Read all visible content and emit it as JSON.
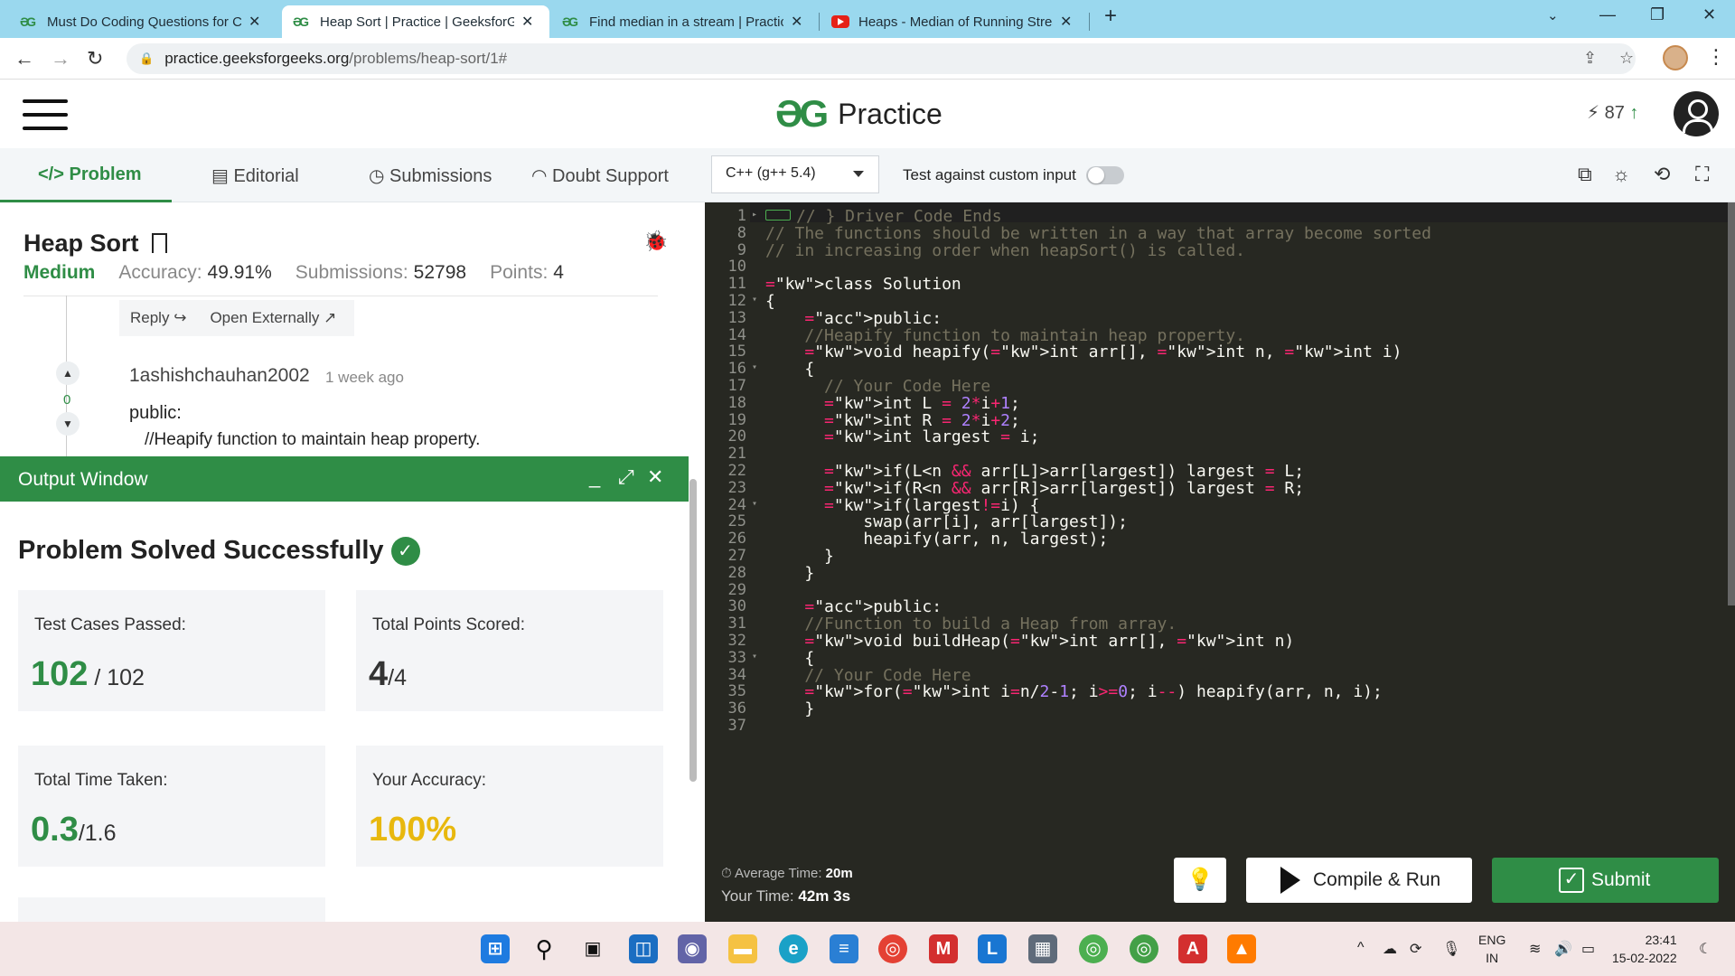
{
  "browser": {
    "tabs": [
      {
        "title": "Must Do Coding Questions for C",
        "favicon": "gfg-icon",
        "active": false
      },
      {
        "title": "Heap Sort | Practice | GeeksforGe",
        "favicon": "gfg-icon",
        "active": true
      },
      {
        "title": "Find median in a stream | Practic",
        "favicon": "gfg-icon",
        "active": false
      },
      {
        "title": "Heaps - Median of Running Strea",
        "favicon": "youtube-icon",
        "active": false
      }
    ],
    "url_host": "practice.geeksforgeeks.org",
    "url_path": "/problems/heap-sort/1#"
  },
  "site": {
    "logo_mark": "ƏG",
    "logo_text": "Practice",
    "streak": "87"
  },
  "problem_tabs": [
    "Problem",
    "Editorial",
    "Submissions",
    "Doubt Support"
  ],
  "problem_tab_icons": [
    "</>",
    "▤",
    "◷",
    "◠"
  ],
  "editor_toolbar": {
    "language": "C++ (g++ 5.4)",
    "custom_input_label": "Test against custom input"
  },
  "problem": {
    "title": "Heap Sort",
    "difficulty": "Medium",
    "accuracy_label": "Accuracy:",
    "accuracy": "49.91%",
    "submissions_label": "Submissions:",
    "submissions": "52798",
    "points_label": "Points:",
    "points": "4"
  },
  "comment": {
    "reply": "Reply",
    "open_externally": "Open Externally",
    "votes": "0",
    "author": "1ashishchauhan2002",
    "time": "1 week ago",
    "line1": "public:",
    "line2": "//Heapify function to maintain heap property."
  },
  "output": {
    "title": "Output Window",
    "status": "Problem Solved Successfully",
    "cards": [
      {
        "label": "Test Cases Passed:",
        "value": "102",
        "total": " / 102"
      },
      {
        "label": "Total Points Scored:",
        "value": "4",
        "total": "/4"
      },
      {
        "label": "Total Time Taken:",
        "value": "0.3",
        "total": "/1.6"
      },
      {
        "label": "Your Accuracy:",
        "value": "100%",
        "total": ""
      }
    ]
  },
  "code": {
    "line_numbers": [
      "1",
      "8",
      "9",
      "10",
      "11",
      "12",
      "13",
      "14",
      "15",
      "16",
      "17",
      "18",
      "19",
      "20",
      "21",
      "22",
      "23",
      "24",
      "25",
      "26",
      "27",
      "28",
      "29",
      "30",
      "31",
      "32",
      "33",
      "34",
      "35",
      "36",
      "37"
    ],
    "lines": [
      "// } Driver Code Ends",
      "// The functions should be written in a way that array become sorted",
      "// in increasing order when heapSort() is called.",
      "",
      "class Solution",
      "{",
      "    public:",
      "    //Heapify function to maintain heap property.",
      "    void heapify(int arr[], int n, int i)",
      "    {",
      "      // Your Code Here",
      "      int L = 2*i+1;",
      "      int R = 2*i+2;",
      "      int largest = i;",
      "",
      "      if(L<n && arr[L]>arr[largest]) largest = L;",
      "      if(R<n && arr[R]>arr[largest]) largest = R;",
      "      if(largest!=i) {",
      "          swap(arr[i], arr[largest]);",
      "          heapify(arr, n, largest);",
      "      }",
      "    }",
      "",
      "    public:",
      "    //Function to build a Heap from array.",
      "    void buildHeap(int arr[], int n)",
      "    {",
      "    // Your Code Here",
      "    for(int i=n/2-1; i>=0; i--) heapify(arr, n, i);",
      "    }",
      ""
    ]
  },
  "actions": {
    "avg_time_label": "Average Time:",
    "avg_time": "20m",
    "your_time_label": "Your Time:",
    "your_time": "42m 3s",
    "compile_run": "Compile & Run",
    "submit": "Submit"
  },
  "taskbar": {
    "lang_line1": "ENG",
    "lang_line2": "IN",
    "time": "23:41",
    "date": "15-02-2022"
  }
}
